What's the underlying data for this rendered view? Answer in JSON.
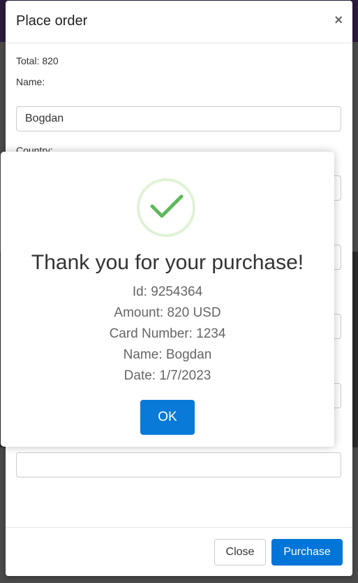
{
  "modal": {
    "title": "Place order",
    "close_symbol": "×",
    "total_label": "Total: 820",
    "name_label": "Name:",
    "name_value": "Bogdan",
    "country_label": "Country:"
  },
  "footer": {
    "close_label": "Close",
    "purchase_label": "Purchase"
  },
  "alert": {
    "icon": "check-icon",
    "title": "Thank you for your purchase!",
    "lines": [
      "Id: 9254364",
      "Amount: 820 USD",
      "Card Number: 1234",
      "Name: Bogdan",
      "Date: 1/7/2023"
    ],
    "ok_label": "OK"
  },
  "colors": {
    "primary": "#0275d8",
    "success": "#5cb85c"
  }
}
